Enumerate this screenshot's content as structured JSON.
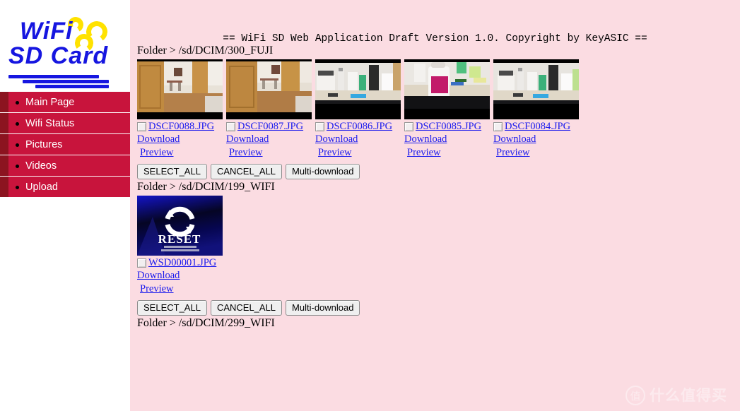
{
  "branding": {
    "logo_line1": "WiFi",
    "logo_line2": "SD Card",
    "logo_text_color": "#1616e0",
    "logo_arc_color": "#ffe200"
  },
  "sidebar": {
    "background_color": "#c8143c",
    "accent_strip_color": "#8c1420",
    "items": [
      {
        "label": "Main Page"
      },
      {
        "label": "Wifi Status"
      },
      {
        "label": "Pictures"
      },
      {
        "label": "Videos"
      },
      {
        "label": "Upload"
      }
    ]
  },
  "main": {
    "background_color": "#fbdce2",
    "app_title": "== WiFi SD Web Application Draft Version 1.0. Copyright by KeyASIC ==",
    "buttons": {
      "select_all": "SELECT_ALL",
      "cancel_all": "CANCEL_ALL",
      "multi_download": "Multi-download"
    },
    "link_labels": {
      "download": "Download",
      "preview": " Preview"
    },
    "sections": [
      {
        "folder_label": "Folder > /sd/DCIM/300_FUJI",
        "files": [
          {
            "name": "DSCF0088.JPG",
            "thumb": "room-a"
          },
          {
            "name": "DSCF0087.JPG",
            "thumb": "room-b"
          },
          {
            "name": "DSCF0086.JPG",
            "thumb": "desk-a"
          },
          {
            "name": "DSCF0085.JPG",
            "thumb": "desk-b"
          },
          {
            "name": "DSCF0084.JPG",
            "thumb": "desk-c"
          }
        ],
        "has_buttons": true
      },
      {
        "folder_label": "Folder > /sd/DCIM/199_WIFI",
        "files": [
          {
            "name": "WSD00001.JPG",
            "thumb": "reset"
          }
        ],
        "has_buttons": true
      },
      {
        "folder_label": "Folder > /sd/DCIM/299_WIFI",
        "files": [],
        "has_buttons": false
      }
    ]
  },
  "watermark": {
    "logo_char": "值",
    "text": "什么值得买"
  }
}
